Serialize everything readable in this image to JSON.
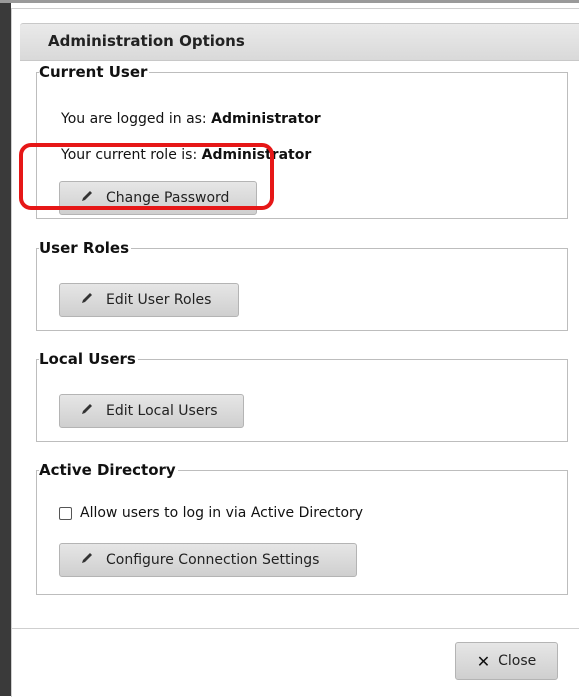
{
  "dialog": {
    "title": "Administration Options"
  },
  "current_user": {
    "legend": "Current User",
    "logged_in_prefix": "You are logged in as:",
    "logged_in_value": "Administrator",
    "role_prefix": "Your current role is:",
    "role_value": "Administrator",
    "change_password_label": "Change Password"
  },
  "user_roles": {
    "legend": "User Roles",
    "edit_label": "Edit User Roles"
  },
  "local_users": {
    "legend": "Local Users",
    "edit_label": "Edit Local Users"
  },
  "active_directory": {
    "legend": "Active Directory",
    "checkbox_label": "Allow users to log in via Active Directory",
    "checkbox_checked": false,
    "configure_label": "Configure Connection Settings"
  },
  "footer": {
    "close_label": "Close"
  },
  "colors": {
    "highlight": "#e61717",
    "button_bg": "#d8d8d8"
  },
  "icons": {
    "edit": "pencil-icon",
    "close": "close-icon"
  }
}
